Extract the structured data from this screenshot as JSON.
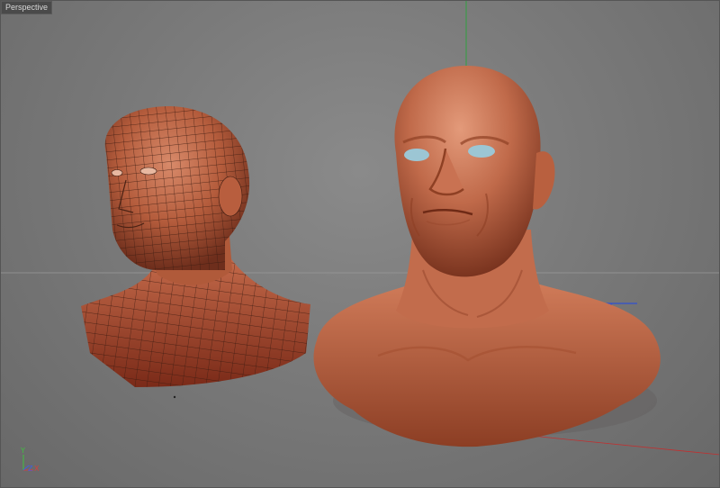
{
  "viewport": {
    "label": "Perspective"
  },
  "axes": {
    "y": "Y",
    "x": "X",
    "z": "Z",
    "colors": {
      "x": "#d04040",
      "y": "#40c040",
      "z": "#4060e0"
    }
  },
  "scene": {
    "objects": [
      "wireframe-head-mesh",
      "sculpted-head-mesh"
    ],
    "skin_color": "#c0684a"
  }
}
